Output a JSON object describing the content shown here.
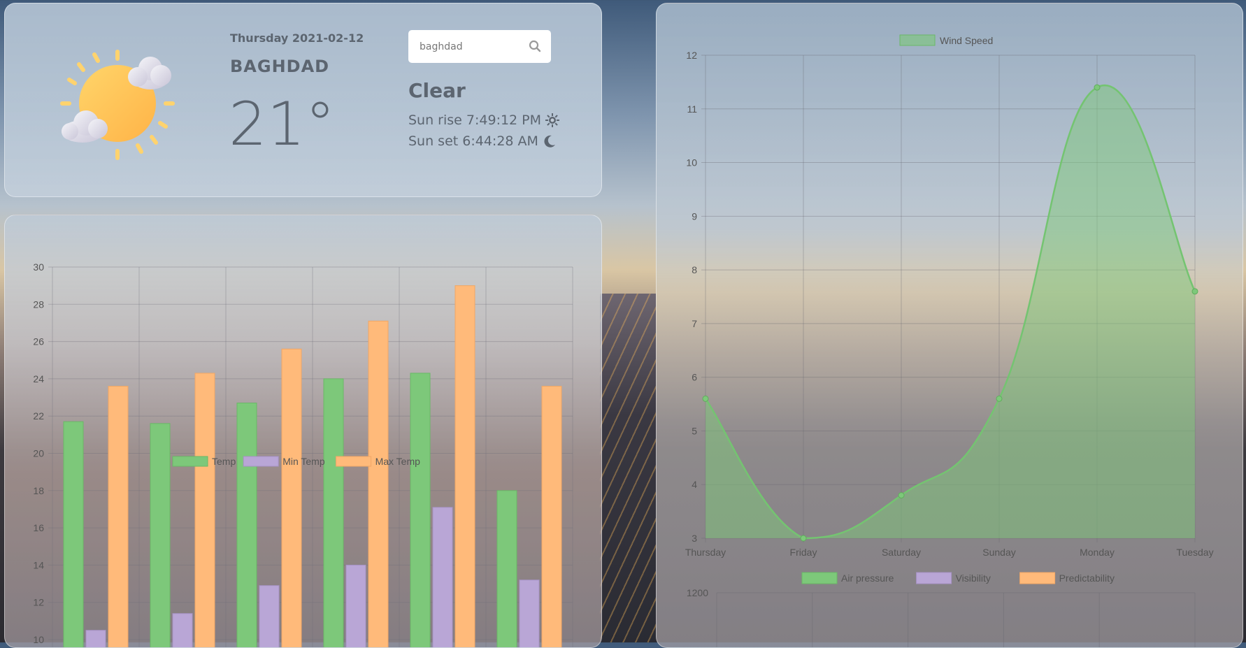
{
  "header": {
    "date": "Thursday 2021-02-12",
    "city": "BAGHDAD",
    "temperature": "21°",
    "condition": "Clear",
    "sunrise": "Sun rise 7:49:12 PM",
    "sunset": "Sun set 6:44:28 AM",
    "weather_icon": "sun-with-clouds-icon",
    "sunrise_icon": "sun-gear-icon",
    "sunset_icon": "moon-icon"
  },
  "search": {
    "value": "baghdad",
    "icon": "search-icon"
  },
  "colors": {
    "green": "#7dc87a",
    "purple": "#b9a6d6",
    "orange": "#ffba7a",
    "text": "#5c6570"
  },
  "chart_data": [
    {
      "type": "bar",
      "legend": [
        "Temp",
        "Min Temp",
        "Max Temp"
      ],
      "categories": [
        "",
        "",
        "",
        "",
        "",
        ""
      ],
      "series": [
        {
          "name": "Temp",
          "values": [
            21.7,
            21.6,
            22.7,
            24.0,
            24.3,
            18.0
          ]
        },
        {
          "name": "Min Temp",
          "values": [
            10.5,
            11.4,
            12.9,
            14.0,
            17.1,
            13.2
          ]
        },
        {
          "name": "Max Temp",
          "values": [
            23.6,
            24.3,
            25.6,
            27.1,
            29.0,
            23.6
          ]
        }
      ],
      "yticks": [
        "10",
        "12",
        "14",
        "16",
        "18",
        "20",
        "22",
        "24",
        "26",
        "28",
        "30"
      ],
      "ylim": [
        10,
        30
      ],
      "grid": true,
      "legend_position": "top"
    },
    {
      "type": "area",
      "legend": [
        "Wind Speed"
      ],
      "x": [
        "Thursday",
        "Friday",
        "Saturday",
        "Sunday",
        "Monday",
        "Tuesday"
      ],
      "series": [
        {
          "name": "Wind Speed",
          "values": [
            5.6,
            3.0,
            3.8,
            5.6,
            11.4,
            7.6
          ]
        }
      ],
      "yticks": [
        "3",
        "4",
        "5",
        "6",
        "7",
        "8",
        "9",
        "10",
        "11",
        "12"
      ],
      "ylim": [
        3,
        12
      ],
      "grid": true,
      "legend_position": "top"
    },
    {
      "type": "line",
      "legend": [
        "Air pressure",
        "Visibility",
        "Predictability"
      ],
      "yticks": [
        "1200"
      ],
      "legend_position": "top"
    }
  ]
}
